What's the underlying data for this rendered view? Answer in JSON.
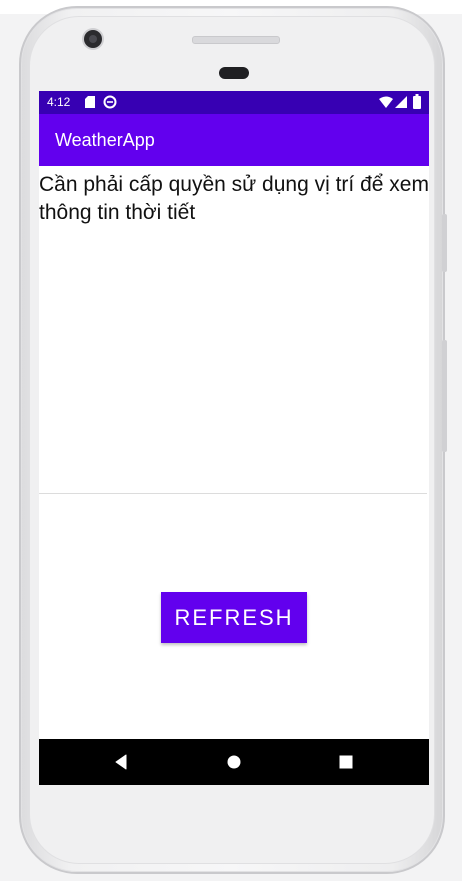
{
  "status_bar": {
    "time": "4:12",
    "icons": [
      "sd-card-icon",
      "data-saver-icon",
      "wifi-icon",
      "signal-icon",
      "battery-icon"
    ]
  },
  "app_bar": {
    "title": "WeatherApp"
  },
  "main": {
    "message": "Cần phải cấp quyền sử dụng vị trí để xem thông tin thời tiết",
    "refresh_label": "REFRESH"
  },
  "nav_bar": {
    "buttons": [
      "back-icon",
      "home-icon",
      "recents-icon"
    ]
  },
  "colors": {
    "status_bar": "#3700b3",
    "primary": "#6200ee",
    "nav_bar": "#000000"
  }
}
